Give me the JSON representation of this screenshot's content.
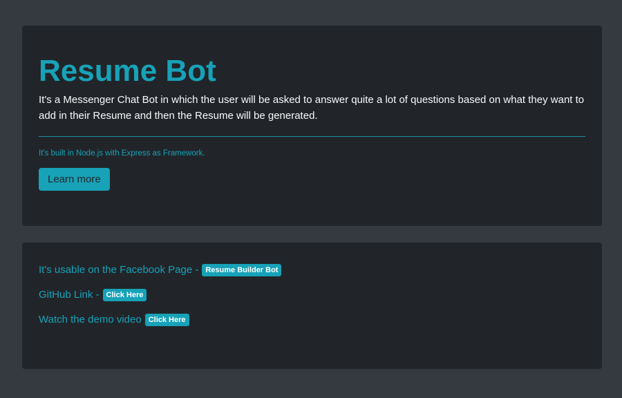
{
  "hero": {
    "title": "Resume Bot",
    "description": "It's a Messenger Chat Bot in which the user will be asked to answer quite a lot of questions based on what they want to add in their Resume and then the Resume will be generated.",
    "note": "It's built in Node.js with Express as Framework.",
    "button_label": "Learn more"
  },
  "links": [
    {
      "text": "It's usable on the Facebook Page -",
      "badge": "Resume Builder Bot"
    },
    {
      "text": "GitHub Link -",
      "badge": "Click Here"
    },
    {
      "text": "Watch the demo video",
      "badge": "Click Here"
    }
  ],
  "colors": {
    "page_bg": "#343a40",
    "card_bg": "#212529",
    "accent": "#17a2b8"
  }
}
